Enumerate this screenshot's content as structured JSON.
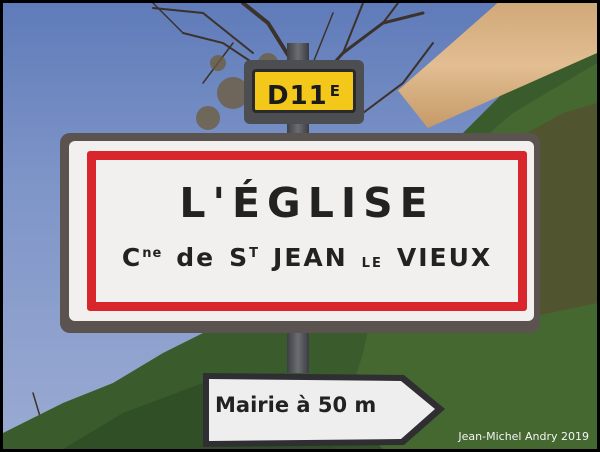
{
  "photo": {
    "road_sign": {
      "code": "D11",
      "suffix": "E"
    },
    "town_sign": {
      "name": "L'ÉGLISE",
      "commune_prefix": "C",
      "commune_prefix_sup": "ne",
      "commune_de": "de",
      "saint": "S",
      "saint_sup": "T",
      "jean": "JEAN",
      "le": "LE",
      "vieux": "VIEUX"
    },
    "direction_sign": {
      "text": "Mairie à 50 m"
    },
    "credit": "Jean-Michel Andry 2019"
  },
  "colors": {
    "sign_red": "#d8262c",
    "road_sign_yellow": "#f4c81b",
    "sky": "#7e95c8",
    "hill_green": "#3a5b2b"
  }
}
